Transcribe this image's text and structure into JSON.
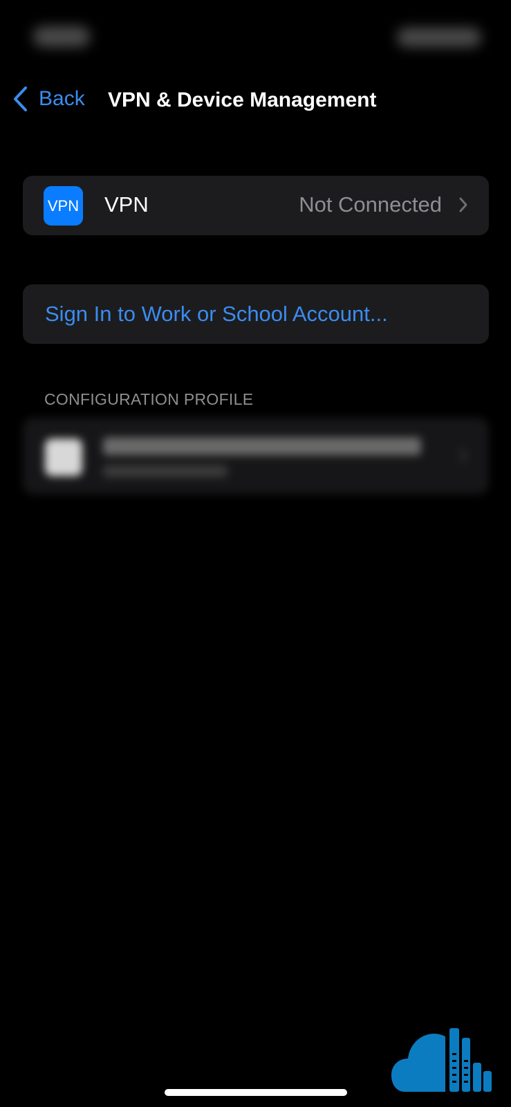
{
  "nav": {
    "back_label": "Back",
    "title": "VPN & Device Management"
  },
  "vpn": {
    "icon_text": "VPN",
    "label": "VPN",
    "status": "Not Connected"
  },
  "sign_in": {
    "label": "Sign In to Work or School Account..."
  },
  "configuration_profile": {
    "header": "CONFIGURATION PROFILE"
  },
  "icons": {
    "back": "chevron-left-icon",
    "row_disclosure": "chevron-right-icon",
    "watermark": "cloud-logo-icon"
  },
  "colors": {
    "background": "#000000",
    "cell": "#1c1c1e",
    "accent": "#3b8cf0",
    "vpn_icon": "#0a7cff",
    "secondary_text": "#8e8e93",
    "watermark": "#0c7cc0"
  }
}
